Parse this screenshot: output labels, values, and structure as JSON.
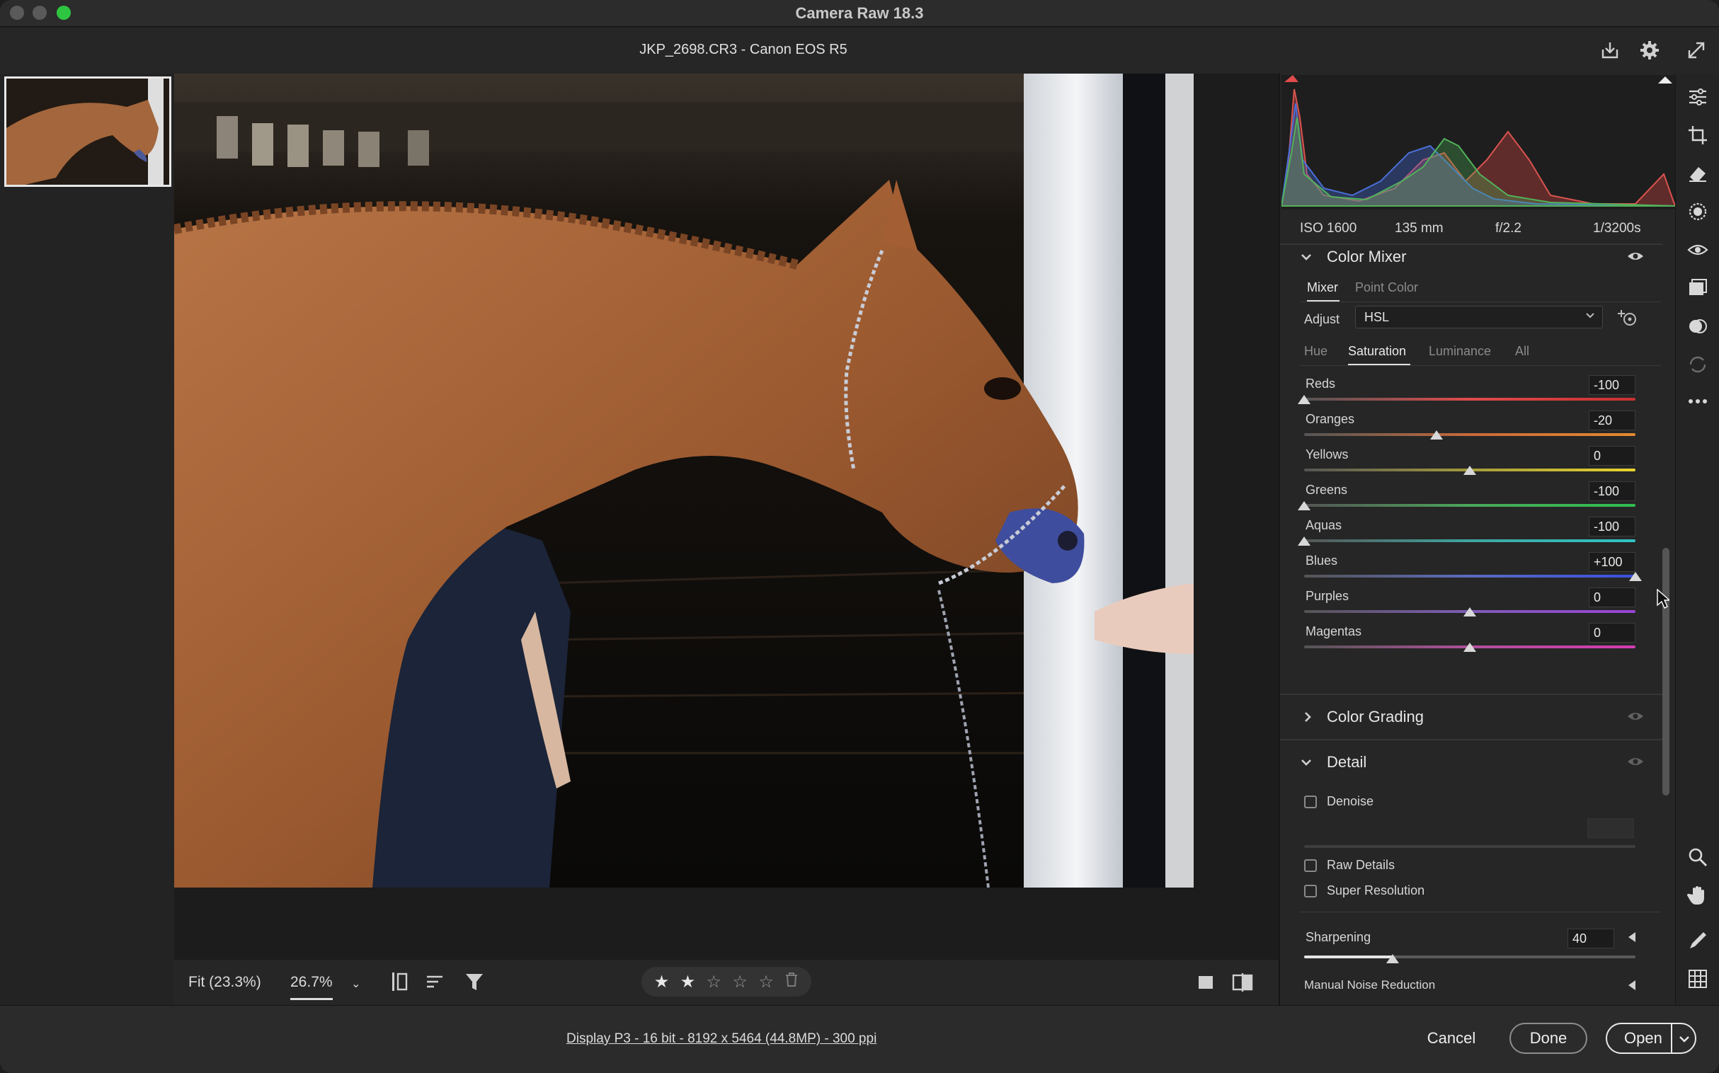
{
  "app": {
    "title": "Camera Raw 18.3"
  },
  "document": {
    "title": "JKP_2698.CR3  -  Canon EOS R5"
  },
  "exif": {
    "iso": "ISO 1600",
    "focal": "135 mm",
    "aperture": "f/2.2",
    "shutter": "1/3200s"
  },
  "color_mixer": {
    "title": "Color Mixer",
    "tabs": [
      "Mixer",
      "Point Color"
    ],
    "active_tab": "Mixer",
    "adjust_label": "Adjust",
    "adjust_value": "HSL",
    "subtabs": [
      "Hue",
      "Saturation",
      "Luminance",
      "All"
    ],
    "active_subtab": "Saturation",
    "sliders": [
      {
        "label": "Reds",
        "value": "-100",
        "num": -100,
        "color_a": "#e04b4b",
        "color_b": "#c93030"
      },
      {
        "label": "Oranges",
        "value": "-20",
        "num": -20,
        "color_a": "#c86a3a",
        "color_b": "#e58a2f"
      },
      {
        "label": "Yellows",
        "value": "0",
        "num": 0,
        "color_a": "#a39b3a",
        "color_b": "#e8d52e"
      },
      {
        "label": "Greens",
        "value": "-100",
        "num": -100,
        "color_a": "#4aa85a",
        "color_b": "#2fbf4f"
      },
      {
        "label": "Aquas",
        "value": "-100",
        "num": -100,
        "color_a": "#3fa6a1",
        "color_b": "#2fc5c5"
      },
      {
        "label": "Blues",
        "value": "+100",
        "num": 100,
        "color_a": "#5b6bbf",
        "color_b": "#3a4fe0"
      },
      {
        "label": "Purples",
        "value": "0",
        "num": 0,
        "color_a": "#7e5cb8",
        "color_b": "#9b44d6"
      },
      {
        "label": "Magentas",
        "value": "0",
        "num": 0,
        "color_a": "#b0509b",
        "color_b": "#d63bb2"
      }
    ]
  },
  "color_grading": {
    "title": "Color Grading"
  },
  "detail": {
    "title": "Detail",
    "denoise": "Denoise",
    "raw_details": "Raw Details",
    "super_resolution": "Super Resolution",
    "sharpening_label": "Sharpening",
    "sharpening_value": "40",
    "sharpening_num": 40,
    "manual_noise": "Manual Noise Reduction"
  },
  "bottombar": {
    "fit": "Fit (23.3%)",
    "zoom": "26.7%",
    "stars": [
      "★",
      "★",
      "☆",
      "☆",
      "☆"
    ],
    "rating": 2
  },
  "footer": {
    "info": "Display P3 - 16 bit - 8192 x 5464 (44.8MP) - 300 ppi",
    "cancel": "Cancel",
    "done": "Done",
    "open": "Open"
  },
  "colors": {
    "accent": "#3a7bd5",
    "panel_bg": "#262626",
    "window_bg": "#1f1f1f"
  },
  "icons": [
    "save-icon",
    "settings-icon",
    "fullscreen-icon",
    "edit-icon",
    "crop-icon",
    "eraser-icon",
    "mask-icon",
    "redeye-icon",
    "snapshots-icon",
    "presets-icon",
    "sync-icon",
    "more-icon",
    "zoom-icon",
    "hand-icon",
    "sampler-icon",
    "grid-icon"
  ]
}
